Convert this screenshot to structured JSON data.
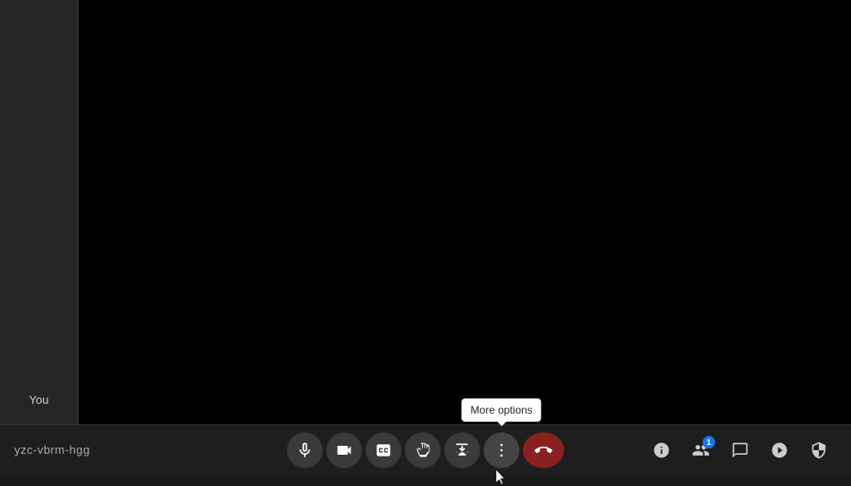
{
  "meeting": {
    "code": "yzc-vbrm-hgg",
    "participant_label": "You"
  },
  "tooltip": {
    "more_options": "More options"
  },
  "controls": {
    "microphone_label": "Microphone",
    "camera_label": "Camera",
    "captions_label": "Captions",
    "raise_hand_label": "Raise hand",
    "present_label": "Present",
    "more_options_label": "More options",
    "end_call_label": "End call",
    "info_label": "Meeting info",
    "participants_label": "Participants",
    "chat_label": "Chat",
    "activities_label": "Activities",
    "safety_label": "Safety"
  },
  "badges": {
    "participants_count": "1"
  }
}
